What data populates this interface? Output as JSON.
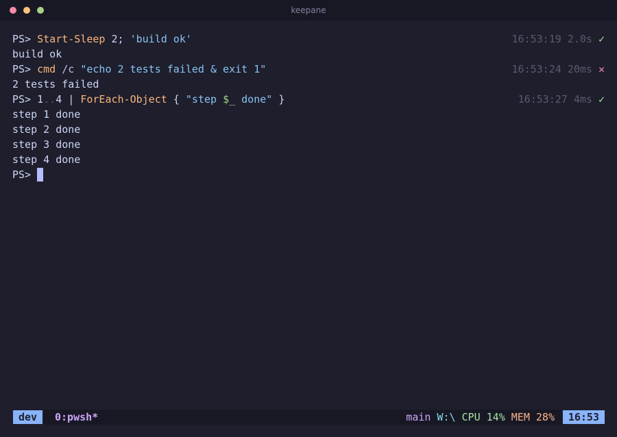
{
  "window": {
    "title": "keepane"
  },
  "terminal": {
    "prompt": "PS>",
    "cmd1": {
      "part1": "Start-Sleep",
      "part2": " 2; ",
      "part3": "'build ok'",
      "time": "16:53:19",
      "duration": "2.0s",
      "status": "✓"
    },
    "out1": "build ok",
    "cmd2": {
      "part1": "cmd",
      "part2": " /c ",
      "part3": "\"echo 2 tests failed & exit 1\"",
      "time": "16:53:24",
      "duration": "20ms",
      "status": "✕"
    },
    "out2": "2 tests failed",
    "cmd3": {
      "part1": "1",
      "part2": "..",
      "part3": "4 | ",
      "part4": "ForEach-Object",
      "part5": " { ",
      "part6": "\"step ",
      "part7": "$_",
      "part8": " done\"",
      "part9": " }",
      "time": "16:53:27",
      "duration": "4ms",
      "status": "✓"
    },
    "out3": [
      "step 1 done",
      "step 2 done",
      "step 3 done",
      "step 4 done"
    ]
  },
  "statusbar": {
    "session": "dev",
    "window": "0:pwsh*",
    "branch": "main",
    "cwd": "W:\\",
    "cpu": "CPU 14%",
    "mem": "MEM 28%",
    "clock": "16:53"
  },
  "colors": {
    "background": "#1e1e2c",
    "accent": "#89b4fa",
    "ok": "#a6e3a1",
    "fail": "#f38ba8"
  }
}
